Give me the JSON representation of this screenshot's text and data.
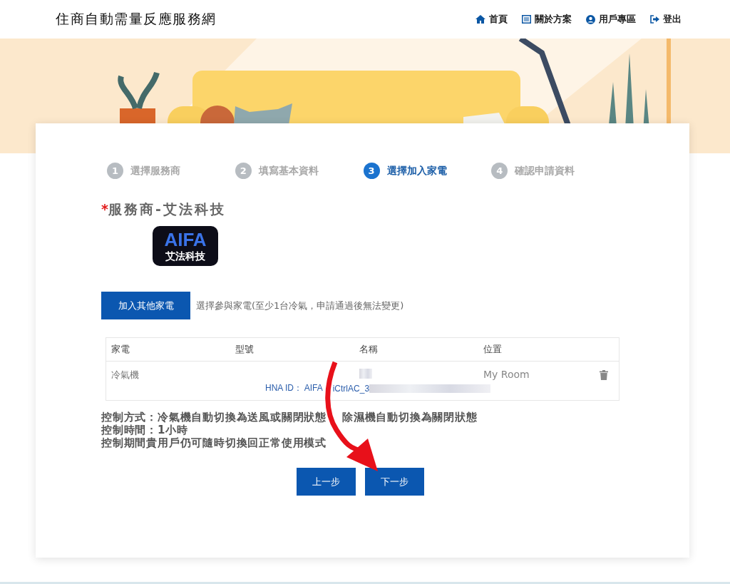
{
  "header": {
    "site_title": "住商自動需量反應服務網",
    "nav": [
      {
        "kind": "home",
        "label": "首頁"
      },
      {
        "kind": "list",
        "label": "關於方案"
      },
      {
        "kind": "user",
        "label": "用戶專區"
      },
      {
        "kind": "logout",
        "label": "登出"
      }
    ]
  },
  "steps": [
    {
      "number": "1",
      "label": "選擇服務商",
      "selected": false
    },
    {
      "number": "2",
      "label": "填寫基本資料",
      "selected": false
    },
    {
      "number": "3",
      "label": "選擇加入家電",
      "selected": true
    },
    {
      "number": "4",
      "label": "確認申請資料",
      "selected": false
    }
  ],
  "provider": {
    "required_mark": "*",
    "title": "服務商-艾法科技",
    "logo_text": "AIFA",
    "logo_subtext": "艾法科技"
  },
  "add_button": "加入其他家電",
  "add_hint": "選擇參與家電(至少1台冷氣，申請通過後無法變更)",
  "table": {
    "columns": [
      "家電",
      "型號",
      "名稱",
      "位置"
    ],
    "rows": [
      {
        "appliance": "冷氣機",
        "location": "My Room",
        "hna_id_parts": [
          "HNA ID： AIFA",
          "iCtrlAC_3"
        ]
      }
    ]
  },
  "notes": [
    [
      "控制方式：冷氣機自動切換為送風或關閉狀態",
      "除濕機自動切換為關閉狀態"
    ],
    [
      "控制時間：1小時"
    ],
    [
      "控制期間貴用戶仍可隨時切換回正常使用模式"
    ]
  ],
  "buttons": [
    "上一步",
    "下一步"
  ]
}
